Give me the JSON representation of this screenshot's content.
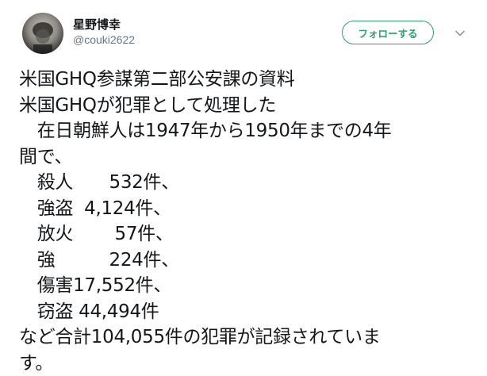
{
  "author": {
    "display_name": "星野博幸",
    "handle": "@couki2622",
    "avatar_icon": "profile-photo-avatar"
  },
  "actions": {
    "follow_label": "フォローする",
    "menu_icon": "chevron-down-icon"
  },
  "colors": {
    "accent": "#2f9e6a",
    "text": "#14171a",
    "secondary_text": "#657786",
    "background": "#ffffff"
  },
  "tweet": {
    "lines": [
      "米国GHQ参謀第二部公安課の資料",
      "米国GHQが犯罪として処理した",
      "　在日朝鮮人は1947年から1950年までの4年",
      "間で、",
      "　殺人　　532件、",
      "　強盗  4,124件、",
      "　放火　　 57件、",
      "　強　　　224件、",
      "　傷害17,552件、",
      "　窃盗 44,494件",
      "など合計104,055件の犯罪が記録されていま",
      "す。"
    ]
  }
}
